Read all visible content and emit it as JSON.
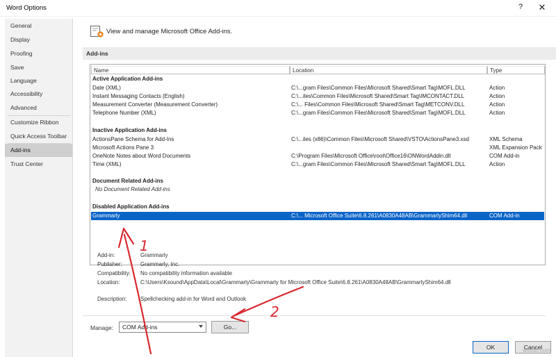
{
  "window": {
    "title": "Word Options",
    "help": "?",
    "close": "✕"
  },
  "sidebar": {
    "items": [
      {
        "label": "General"
      },
      {
        "label": "Display"
      },
      {
        "label": "Proofing"
      },
      {
        "label": "Save"
      },
      {
        "label": "Language"
      },
      {
        "label": "Accessibility"
      },
      {
        "label": "Advanced"
      },
      {
        "label": "Customize Ribbon"
      },
      {
        "label": "Quick Access Toolbar"
      },
      {
        "label": "Add-ins"
      },
      {
        "label": "Trust Center"
      }
    ],
    "active": "Add-ins"
  },
  "main": {
    "header": "View and manage Microsoft Office Add-ins.",
    "section": "Add-ins"
  },
  "table": {
    "columns": [
      "Name",
      "Location",
      "Type"
    ],
    "groups": [
      {
        "title": "Active Application Add-ins",
        "rows": [
          {
            "name": "Date (XML)",
            "location": "C:\\...gram Files\\Common Files\\Microsoft Shared\\Smart Tag\\MOFL.DLL",
            "type": "Action"
          },
          {
            "name": "Instant Messaging Contacts (English)",
            "location": "C:\\...iles\\Common Files\\Microsoft Shared\\Smart Tag\\IMCONTACT.DLL",
            "type": "Action"
          },
          {
            "name": "Measurement Converter (Measurement Converter)",
            "location": "C:\\... Files\\Common Files\\Microsoft Shared\\Smart Tag\\METCONV.DLL",
            "type": "Action"
          },
          {
            "name": "Telephone Number (XML)",
            "location": "C:\\...gram Files\\Common Files\\Microsoft Shared\\Smart Tag\\MOFL.DLL",
            "type": "Action"
          }
        ]
      },
      {
        "title": "Inactive Application Add-ins",
        "rows": [
          {
            "name": "ActionsPane Schema for Add-Ins",
            "location": "C:\\...iles (x86)\\Common Files\\Microsoft Shared\\VSTO\\ActionsPane3.xsd",
            "type": "XML Schema"
          },
          {
            "name": "Microsoft Actions Pane 3",
            "location": "",
            "type": "XML Expansion Pack"
          },
          {
            "name": "OneNote Notes about Word Documents",
            "location": "C:\\Program Files\\Microsoft Office\\root\\Office16\\ONWordAddin.dll",
            "type": "COM Add-in"
          },
          {
            "name": "Time (XML)",
            "location": "C:\\...gram Files\\Common Files\\Microsoft Shared\\Smart Tag\\MOFL.DLL",
            "type": "Action"
          }
        ]
      },
      {
        "title": "Document Related Add-ins",
        "empty": "No Document Related Add-ins"
      },
      {
        "title": "Disabled Application Add-ins",
        "rows": [
          {
            "name": "Grammarly",
            "location": "C:\\... Microsoft Office Suite\\6.8.261\\A0830A48AB\\GrammarlyShim64.dll",
            "type": "COM Add-in",
            "selected": true
          }
        ]
      }
    ]
  },
  "details": {
    "addin_label": "Add-in:",
    "addin_value": "Grammarly",
    "publisher_label": "Publisher:",
    "publisher_value": "Grammarly, Inc.",
    "compat_label": "Compatibility:",
    "compat_value": "No compatibility information available",
    "location_label": "Location:",
    "location_value": "C:\\Users\\Ksound\\AppData\\Local\\Grammarly\\Grammarly for Microsoft Office Suite\\6.8.261\\A0830A48AB\\GrammarlyShim64.dll",
    "desc_label": "Description:",
    "desc_value": "Spellchecking add-in for Word and Outlook"
  },
  "manage": {
    "label": "Manage:",
    "selected": "COM Add-ins",
    "go": "Go..."
  },
  "buttons": {
    "ok": "OK",
    "cancel": "Cancel"
  },
  "annotations": {
    "mark1": "1",
    "mark2": "2"
  },
  "watermark": "wsxdn.com",
  "colors": {
    "selection": "#0a64c8",
    "annotation": "#d9262e"
  }
}
